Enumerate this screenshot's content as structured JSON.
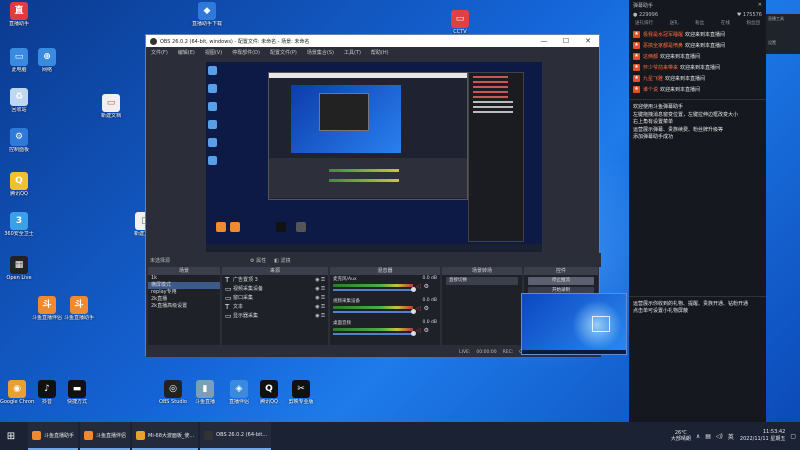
{
  "desktop": {
    "icons": [
      {
        "label": "直播助手",
        "color": "#e23b3b",
        "glyph": "直"
      },
      {
        "label": "此电脑",
        "color": "#3a8ae0",
        "glyph": "▭"
      },
      {
        "label": "网络",
        "color": "#3a8ae0",
        "glyph": "⊕"
      },
      {
        "label": "回收站",
        "color": "#bfd8f0",
        "glyph": "♻"
      },
      {
        "label": "控制面板",
        "color": "#2f7ad8",
        "glyph": "⚙"
      },
      {
        "label": "腾讯QQ",
        "color": "#f0c030",
        "glyph": "Q"
      },
      {
        "label": "360安全卫士",
        "color": "#3aa0e8",
        "glyph": "3"
      },
      {
        "label": "Open Live",
        "color": "#222",
        "glyph": "▦"
      },
      {
        "label": "斗鱼直播伴侣",
        "color": "#f08a30",
        "glyph": "斗"
      },
      {
        "label": "斗鱼直播助手",
        "color": "#f08a30",
        "glyph": "斗"
      }
    ],
    "top_icons": [
      {
        "label": "直播助手下载",
        "color": "#2f7ad8",
        "glyph": "◆"
      },
      {
        "label": "CCTV",
        "color": "#e04040",
        "glyph": "▭"
      }
    ],
    "mid_icons": [
      {
        "label": "新建文档",
        "color": "#f0f0f0",
        "glyph": "▭"
      },
      {
        "label": "新建文本",
        "color": "#f0f0f0",
        "glyph": "▯"
      }
    ],
    "bottom_icons": [
      {
        "label": "Google Chrome",
        "color": "#e8a030",
        "glyph": "◉"
      },
      {
        "label": "抖音",
        "color": "#111",
        "glyph": "♪"
      },
      {
        "label": "快捷方式",
        "color": "#111",
        "glyph": "▬"
      },
      {
        "label": "OBS Studio",
        "color": "#222",
        "glyph": "◎"
      },
      {
        "label": "斗鱼直播",
        "color": "#7a9fb8",
        "glyph": "▮"
      },
      {
        "label": "直播伴侣",
        "color": "#3a8ae0",
        "glyph": "◈"
      },
      {
        "label": "腾讯QQ",
        "color": "#111",
        "glyph": "Q"
      },
      {
        "label": "剪映专业版",
        "color": "#111",
        "glyph": "✂"
      }
    ]
  },
  "obs": {
    "title": "OBS 26.0.2 (64-bit, windows) - 配置文件: 未命名 - 场景: 未命名",
    "menu": [
      "文件(F)",
      "编辑(E)",
      "视图(V)",
      "停靠部件(D)",
      "配置文件(P)",
      "场景集合(S)",
      "工具(T)",
      "帮助(H)"
    ],
    "mid_label": "未选择源",
    "mid_buttons": [
      "属性",
      "滤镜"
    ],
    "docks": {
      "scenes": {
        "title": "场景",
        "items": [
          "1k",
          "横屏模式",
          "replay专用",
          "2k直播",
          "2k直播高级设置"
        ],
        "selected": 1
      },
      "sources": {
        "title": "来源",
        "items": [
          {
            "icon": "T",
            "label": "广告置顶 3"
          },
          {
            "icon": "▭",
            "label": "视频采集设备"
          },
          {
            "icon": "▭",
            "label": "窗口采集"
          },
          {
            "icon": "T",
            "label": "文本"
          },
          {
            "icon": "▭",
            "label": "显示器采集"
          }
        ]
      },
      "mixer": {
        "title": "混音器",
        "rows": [
          {
            "name": "麦克风/Aux",
            "db": "0.0 dB"
          },
          {
            "name": "视频采集设备",
            "db": "0.0 dB"
          },
          {
            "name": "桌面音频",
            "db": "0.0 dB"
          }
        ]
      },
      "transitions": {
        "title": "场景转场",
        "value": "直接切换"
      },
      "controls": {
        "title": "控件",
        "buttons": [
          "停止推流",
          "开始录制"
        ]
      }
    },
    "status": {
      "live_label": "LIVE:",
      "live_time": "00:00:00",
      "rec_label": "REC:",
      "rec_time": "00:00:00",
      "cpu": "CPU: 1.6%, 30.00 fps"
    }
  },
  "panel": {
    "title": "弹幕助手",
    "stat_left": "229996",
    "stat_right": "175576",
    "tabs": [
      "送礼排行",
      "送礼",
      "粉丝",
      "在线",
      "粉丝团"
    ],
    "messages": [
      {
        "name": "极我是水冠军睡醒",
        "text": "欢迎来到本直播间"
      },
      {
        "name": "恶搞全家都是喷鼻",
        "text": "欢迎来到本直播间"
      },
      {
        "name": "这俩都",
        "text": "欢迎来到本直播间"
      },
      {
        "name": "怀少爷前来带来",
        "text": "欢迎来到本直播间"
      },
      {
        "name": "九星飞雅",
        "text": "欢迎来到本直播间"
      },
      {
        "name": "谁个说",
        "text": "欢迎来到本直播间"
      }
    ],
    "info_lines": [
      "欢迎使用斗鱼弹幕助手",
      "左键拖拽消息窗变位置，左键拉伸边框改变大小",
      "右上角有设置菜单",
      "运营展示弹幕、贵族续费、粉丝牌升级等",
      "添加弹幕助手成功"
    ],
    "info_lines2": [
      "运营展示你收到的礼物、提醒、贵族开通、钻粉开通",
      "点击单可设置小礼物屏蔽"
    ],
    "side_labels": [
      "直播工具",
      "设置"
    ]
  },
  "taskbar": {
    "apps": [
      {
        "label": "斗鱼直播助手",
        "color": "#f08a30"
      },
      {
        "label": "斗鱼直播伴侣",
        "color": "#f08a30"
      },
      {
        "label": "Mi-68大波面板_使...",
        "color": "#e8a030"
      },
      {
        "label": "OBS 26.0.2 (64-bit...",
        "color": "#333"
      }
    ],
    "weather": "26℃",
    "weather_sub": "大部晴朗",
    "time": "11:53:42",
    "date": "2022/11/11 星期五"
  }
}
